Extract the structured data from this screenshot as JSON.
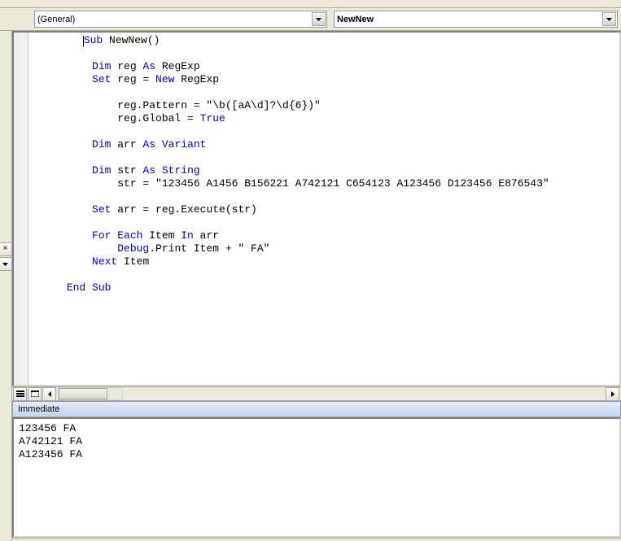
{
  "dropdowns": {
    "object": "(General)",
    "procedure": "NewNew"
  },
  "code": {
    "tokens": [
      [
        [
          "plain",
          "      "
        ],
        [
          "cursor",
          ""
        ],
        [
          "kw",
          "Sub"
        ],
        [
          "plain",
          " NewNew()"
        ]
      ],
      [
        [
          "plain",
          ""
        ]
      ],
      [
        [
          "plain",
          "          "
        ],
        [
          "kw",
          "Dim"
        ],
        [
          "plain",
          " reg "
        ],
        [
          "kw",
          "As"
        ],
        [
          "plain",
          " RegExp"
        ]
      ],
      [
        [
          "plain",
          "          "
        ],
        [
          "kw",
          "Set"
        ],
        [
          "plain",
          " reg = "
        ],
        [
          "kw",
          "New"
        ],
        [
          "plain",
          " RegExp"
        ]
      ],
      [
        [
          "plain",
          ""
        ]
      ],
      [
        [
          "plain",
          "              reg.Pattern = \"\\b([aA\\d]?\\d{6})\""
        ]
      ],
      [
        [
          "plain",
          "              reg.Global = "
        ],
        [
          "kw",
          "True"
        ]
      ],
      [
        [
          "plain",
          ""
        ]
      ],
      [
        [
          "plain",
          "          "
        ],
        [
          "kw",
          "Dim"
        ],
        [
          "plain",
          " arr "
        ],
        [
          "kw",
          "As"
        ],
        [
          "plain",
          " "
        ],
        [
          "kw",
          "Variant"
        ]
      ],
      [
        [
          "plain",
          ""
        ]
      ],
      [
        [
          "plain",
          "          "
        ],
        [
          "kw",
          "Dim"
        ],
        [
          "plain",
          " str "
        ],
        [
          "kw",
          "As"
        ],
        [
          "plain",
          " "
        ],
        [
          "kw",
          "String"
        ]
      ],
      [
        [
          "plain",
          "              str = \"123456 A1456 B156221 A742121 C654123 A123456 D123456 E876543\""
        ]
      ],
      [
        [
          "plain",
          ""
        ]
      ],
      [
        [
          "plain",
          "          "
        ],
        [
          "kw",
          "Set"
        ],
        [
          "plain",
          " arr = reg.Execute(str)"
        ]
      ],
      [
        [
          "plain",
          ""
        ]
      ],
      [
        [
          "plain",
          "          "
        ],
        [
          "kw",
          "For Each"
        ],
        [
          "plain",
          " Item "
        ],
        [
          "kw",
          "In"
        ],
        [
          "plain",
          " arr"
        ]
      ],
      [
        [
          "plain",
          "              "
        ],
        [
          "kw",
          "Debug"
        ],
        [
          "plain",
          ".Print Item + \" FA\""
        ]
      ],
      [
        [
          "plain",
          "          "
        ],
        [
          "kw",
          "Next"
        ],
        [
          "plain",
          " Item"
        ]
      ],
      [
        [
          "plain",
          ""
        ]
      ],
      [
        [
          "plain",
          "      "
        ],
        [
          "kw",
          "End Sub"
        ]
      ]
    ]
  },
  "immediate": {
    "title": "Immediate",
    "lines": [
      "123456 FA",
      "A742121 FA",
      "A123456 FA"
    ]
  },
  "icons": {
    "close_x": "×"
  }
}
